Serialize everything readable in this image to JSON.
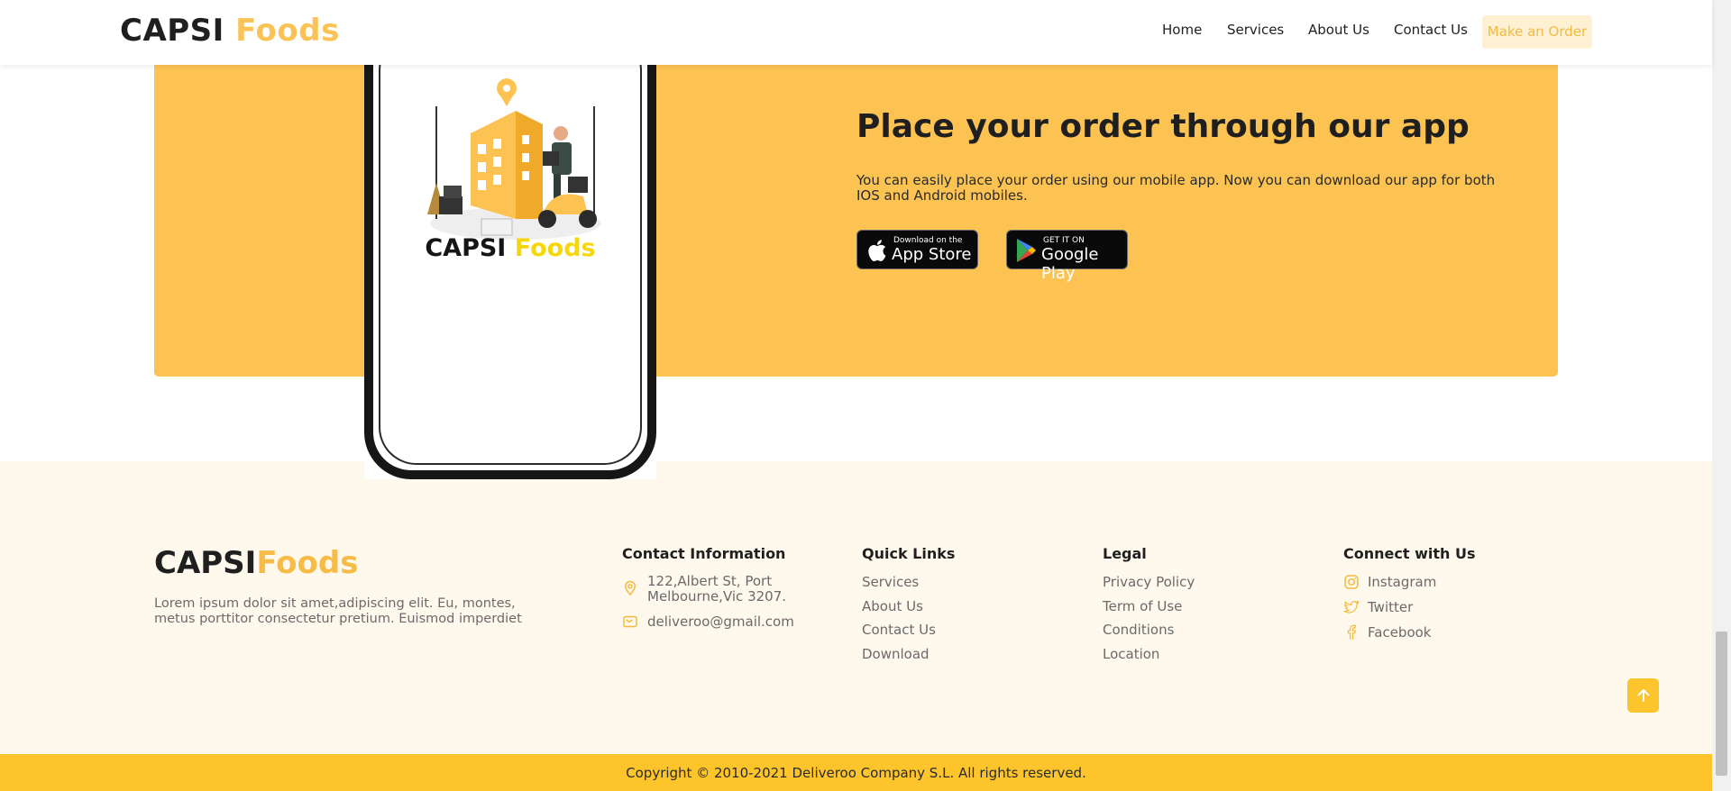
{
  "header": {
    "logo_part1": "CAPSI",
    "logo_part2": "Foods",
    "nav": [
      "Home",
      "Services",
      "About Us",
      "Contact Us"
    ],
    "cta": "Make an Order"
  },
  "app_section": {
    "phone_logo_part1": "CAPSI",
    "phone_logo_part2": "Foods",
    "title": "Place your order through our app",
    "description": "You can easily place your order using our mobile app. Now you can download our app for both IOS and Android mobiles.",
    "app_store": {
      "small": "Download on the",
      "big": "App Store"
    },
    "google_play": {
      "small": "GET IT ON",
      "big": "Google Play"
    }
  },
  "footer": {
    "logo_part1": "CAPSI",
    "logo_part2": "Foods",
    "description": "Lorem ipsum dolor sit amet,adipiscing elit. Eu, montes, metus porttitor consectetur pretium. Euismod imperdiet",
    "contact": {
      "heading": "Contact Information",
      "address": "122,Albert St, Port Melbourne,Vic 3207.",
      "email": "deliveroo@gmail.com"
    },
    "quick_links": {
      "heading": "Quick Links",
      "items": [
        "Services",
        "About Us",
        "Contact Us",
        "Download"
      ]
    },
    "legal": {
      "heading": "Legal",
      "items": [
        "Privacy Policy",
        "Term of Use",
        "Conditions",
        "Location"
      ]
    },
    "social": {
      "heading": "Connect with Us",
      "items": [
        "Instagram",
        "Twitter",
        "Facebook"
      ]
    },
    "copyright": "Copyright © 2010-2021 Deliveroo Company S.L. All rights reserved."
  },
  "colors": {
    "accent": "#fcc353",
    "footer_bg": "#fef9ec",
    "copyright_bg": "#fdc52b",
    "text_dark": "#1f1f1f"
  },
  "icons": [
    "apple-icon",
    "google-play-icon",
    "location-icon",
    "email-icon",
    "instagram-icon",
    "twitter-icon",
    "facebook-icon",
    "arrow-up-icon"
  ]
}
